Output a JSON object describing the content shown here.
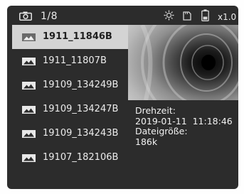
{
  "status_bar": {
    "counter": "1/8",
    "zoom": "x1.0",
    "icons": [
      "camera-icon",
      "brightness-icon",
      "sd-card-icon",
      "battery-icon"
    ]
  },
  "file_list": {
    "selected_index": 0,
    "items": [
      {
        "name": "1911_11846B",
        "icon": "image-icon"
      },
      {
        "name": "1911_11807B",
        "icon": "image-icon"
      },
      {
        "name": "19109_134249B",
        "icon": "image-icon"
      },
      {
        "name": "19109_134247B",
        "icon": "image-icon"
      },
      {
        "name": "19109_134243B",
        "icon": "image-icon"
      },
      {
        "name": "19107_182106B",
        "icon": "image-icon"
      }
    ]
  },
  "info": {
    "time_label": "Drehzeit:",
    "time_value": "2019-01-11  11:18:46",
    "size_label": "Dateigröße:",
    "size_value": "186k"
  },
  "colors": {
    "screen_bg": "#2c2c2c",
    "selected_bg": "#d4d4d4",
    "text": "#ececec"
  }
}
